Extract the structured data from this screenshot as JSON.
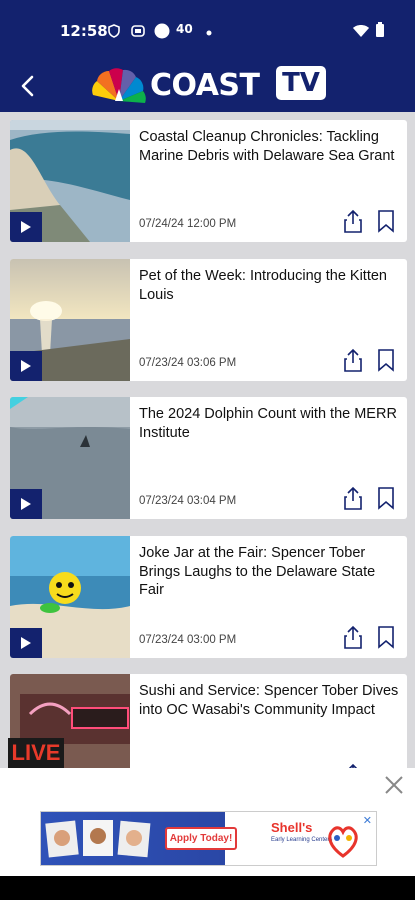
{
  "status_bar": {
    "time": "12:58",
    "badge": "40"
  },
  "app": {
    "name": "COAST",
    "suffix": "TV"
  },
  "videos": [
    {
      "title": "Coastal Cleanup Chronicles: Tackling Marine Debris with Delaware Sea Grant",
      "date": "07/24/24 12:00 PM"
    },
    {
      "title": "Pet of the Week: Introducing the Kitten Louis",
      "date": "07/23/24 03:06 PM"
    },
    {
      "title": "The 2024 Dolphin Count with the MERR Institute",
      "date": "07/23/24 03:04 PM"
    },
    {
      "title": "Joke Jar at the Fair: Spencer Tober Brings Laughs to the Delaware State Fair",
      "date": "07/23/24 03:00 PM"
    },
    {
      "title": "Sushi and Service: Spencer Tober Dives into OC Wasabi's Community Impact",
      "date": ""
    }
  ],
  "live_label": "LIVE",
  "ad": {
    "cta": "Apply Today!",
    "brand": "Shell's",
    "tagline": "Early Learning Centers"
  },
  "colors": {
    "brand_navy": "#13226e",
    "live_red": "#e83a2a"
  }
}
